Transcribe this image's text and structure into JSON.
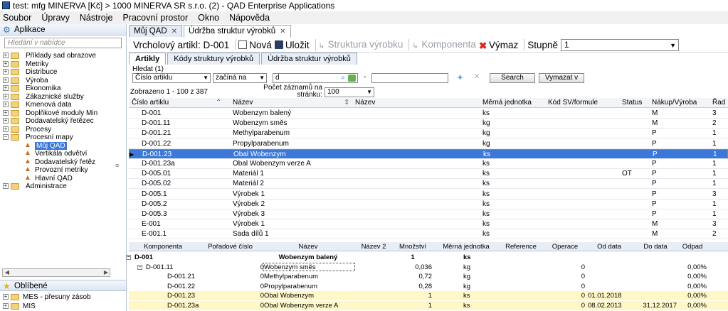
{
  "window": {
    "title": "test: mfg MINERVA [Kč] > 1000 MINERVA SR s.r.o. (2) - QAD Enterprise Applications"
  },
  "menu": [
    "Soubor",
    "Úpravy",
    "Nástroje",
    "Pracovní prostor",
    "Okno",
    "Nápověda"
  ],
  "sidebar": {
    "header": "Aplikace",
    "search_placeholder": "Hledání v nabídce",
    "items": [
      "Příklady sad obrazove",
      "Metriky",
      "Distribuce",
      "Výroba",
      "Ekonomika",
      "Zákaznické služby",
      "Kmenová data",
      "Doplňkové moduly Min",
      "Dodavatelský řetězec",
      "Procesy",
      "Procesní mapy"
    ],
    "subitems": [
      "Můj QAD",
      "Vertikála odvětví",
      "Dodavatelský řetěz",
      "Provozní metriky",
      "Hlavní QAD"
    ],
    "last_item": "Administrace",
    "favorites_header": "Oblíbené",
    "favorites": [
      "MES - přesuny zásob",
      "MIS"
    ]
  },
  "tabs": [
    {
      "label": "Můj QAD"
    },
    {
      "label": "Údržba struktur výrobků"
    }
  ],
  "toolbar": {
    "title": "Vrcholový artikl: D-001",
    "new": "Nová",
    "save": "Uložit",
    "structure": "Struktura výrobku",
    "component": "Komponenta",
    "delete": "Výmaz",
    "level_label": "Stupně",
    "level_value": "1"
  },
  "subtabs": [
    "Artikly",
    "Kódy struktury výrobků",
    "Údržba struktur výrobků"
  ],
  "filter": {
    "label": "Hledat (1)",
    "field": "Číslo artiklu",
    "op": "začíná na",
    "value": "d",
    "dash": "-",
    "search_btn": "Search",
    "clear_btn": "Vymazat v"
  },
  "info": {
    "shown": "Zobrazeno 1 - 100 z 387",
    "records_label_1": "Počet záznamů na",
    "records_label_2": "stránku:",
    "records_value": "100"
  },
  "table": {
    "columns": [
      "Číslo artiklu",
      "Název",
      "Název",
      "Měrná jednotka",
      "Kód SV/formule",
      "Status",
      "Nákup/Výroba",
      "Řad"
    ],
    "rows": [
      [
        "D-001",
        "Wobenzym balený",
        "",
        "ks",
        "",
        "",
        "M",
        "3"
      ],
      [
        "D-001.11",
        "Wobenzym směs",
        "",
        "kg",
        "",
        "",
        "M",
        "2"
      ],
      [
        "D-001.21",
        "Methylparabenum",
        "",
        "kg",
        "",
        "",
        "P",
        "1"
      ],
      [
        "D-001.22",
        "Propylparabenum",
        "",
        "kg",
        "",
        "",
        "P",
        "1"
      ],
      [
        "D-001.23",
        "Obal Wobenzym",
        "",
        "ks",
        "",
        "",
        "P",
        "1"
      ],
      [
        "D-001.23a",
        "Obal Wobenzym verze A",
        "",
        "ks",
        "",
        "",
        "P",
        "1"
      ],
      [
        "D-005.01",
        "Materiál 1",
        "",
        "ks",
        "",
        "OT",
        "P",
        "1"
      ],
      [
        "D-005.02",
        "Materiál 2",
        "",
        "ks",
        "",
        "",
        "P",
        "1"
      ],
      [
        "D-005.1",
        "Výrobek 1",
        "",
        "ks",
        "",
        "",
        "P",
        "3"
      ],
      [
        "D-005.2",
        "Výrobek 2",
        "",
        "ks",
        "",
        "",
        "P",
        "1"
      ],
      [
        "D-005.3",
        "Výrobek 3",
        "",
        "ks",
        "",
        "",
        "P",
        "1"
      ],
      [
        "E-001",
        "Výrobek 1",
        "",
        "ks",
        "",
        "",
        "M",
        "3"
      ],
      [
        "E-001.1",
        "Sada dílů 1",
        "",
        "ks",
        "",
        "",
        "M",
        "2"
      ]
    ]
  },
  "bom": {
    "columns": [
      "Komponenta",
      "Pořadové číslo",
      "Název",
      "Název 2",
      "Množství",
      "Měrná jednotka",
      "Reference",
      "Operace",
      "Od data",
      "Do data",
      "Odpad"
    ],
    "rows": [
      [
        "D-001",
        "",
        "Wobenzym balený",
        "",
        "1",
        "ks",
        "",
        "",
        "",
        "",
        ""
      ],
      [
        "D-001.11",
        "0",
        "Wobenzym směs",
        "",
        "0,036",
        "kg",
        "",
        "0",
        "",
        "",
        "0,00%"
      ],
      [
        "D-001.21",
        "0",
        "Methylparabenum",
        "",
        "0,72",
        "kg",
        "",
        "0",
        "",
        "",
        "0,00%"
      ],
      [
        "D-001.22",
        "0",
        "Propylparabenum",
        "",
        "0,28",
        "kg",
        "",
        "0",
        "",
        "",
        "0,00%"
      ],
      [
        "D-001.23",
        "0",
        "Obal Wobenzym",
        "",
        "1",
        "ks",
        "",
        "0",
        "01.01.2018",
        "",
        "0,00%"
      ],
      [
        "D-001.23a",
        "0",
        "Obal Wobenzym verze A",
        "",
        "1",
        "ks",
        "",
        "0",
        "08.02.2013",
        "31.12.2017",
        "0,00%"
      ]
    ]
  }
}
